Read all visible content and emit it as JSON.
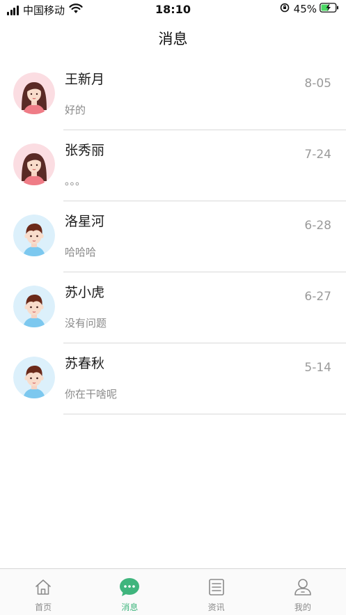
{
  "status_bar": {
    "carrier": "中国移动",
    "time": "18:10",
    "battery_percent": "45%"
  },
  "header": {
    "title": "消息"
  },
  "messages": [
    {
      "name": "王新月",
      "preview": "好的",
      "date": "8-05",
      "avatar": "female-avatar"
    },
    {
      "name": "张秀丽",
      "preview": "。。。",
      "date": "7-24",
      "avatar": "female-avatar"
    },
    {
      "name": "洛星河",
      "preview": "哈哈哈",
      "date": "6-28",
      "avatar": "male-avatar"
    },
    {
      "name": "苏小虎",
      "preview": "没有问题",
      "date": "6-27",
      "avatar": "male-avatar"
    },
    {
      "name": "苏春秋",
      "preview": "你在干啥呢",
      "date": "5-14",
      "avatar": "male-avatar"
    }
  ],
  "tab_bar": {
    "tabs": [
      {
        "label": "首页",
        "icon": "home-icon"
      },
      {
        "label": "消息",
        "icon": "chat-bubble-icon"
      },
      {
        "label": "资讯",
        "icon": "news-icon"
      },
      {
        "label": "我的",
        "icon": "profile-icon"
      }
    ],
    "active_index": 1
  },
  "colors": {
    "accent": "#3fb57d",
    "female_avatar_bg": "#fbdde2",
    "male_avatar_bg": "#dcf0fb"
  }
}
